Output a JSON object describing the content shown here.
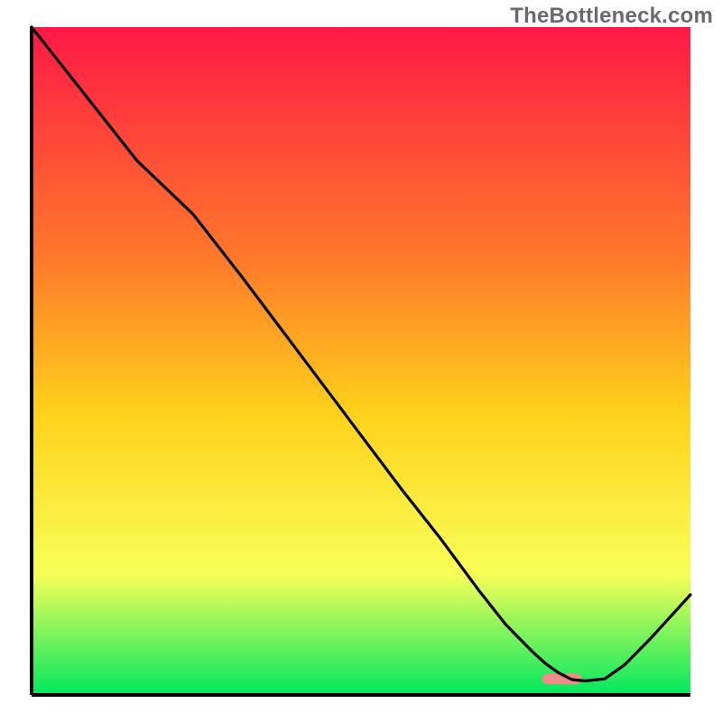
{
  "watermark": "TheBottleneck.com",
  "chart_data": {
    "type": "line",
    "title": "",
    "xlabel": "",
    "ylabel": "",
    "xlim": [
      0,
      100
    ],
    "ylim": [
      0,
      100
    ],
    "x": [
      0,
      4,
      8,
      12,
      16,
      24.5,
      32,
      40,
      48,
      56,
      62,
      68,
      72,
      74,
      76,
      78,
      80,
      82,
      84,
      87,
      90,
      94,
      100
    ],
    "values": [
      100,
      95,
      90,
      85,
      80,
      72,
      62.5,
      52,
      41.5,
      31,
      23.5,
      15.5,
      10.5,
      8.5,
      6.5,
      4.7,
      3.3,
      2.3,
      2.1,
      2.4,
      4.5,
      8.5,
      15
    ],
    "marker": {
      "x": 80.5,
      "y": 2.4,
      "width": 6,
      "height": 1.6,
      "color": "#f28a8a"
    }
  },
  "colors": {
    "gradient_top": "#ff1846",
    "gradient_mid1": "#ff7a2a",
    "gradient_mid2": "#ffd21b",
    "gradient_mid3": "#f7ff57",
    "gradient_bottom": "#00e860",
    "axis": "#000000",
    "line": "#000000",
    "marker": "#f28a8a",
    "watermark": "#6a6a6a"
  }
}
